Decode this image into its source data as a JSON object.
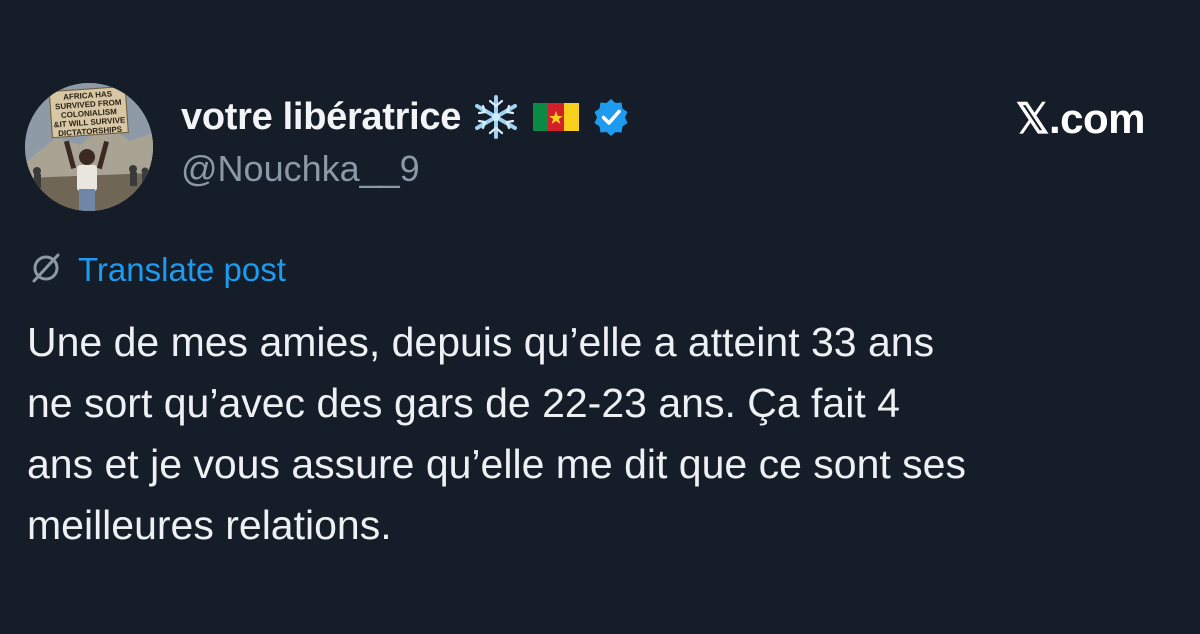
{
  "author": {
    "display_name": "votre libératrice",
    "handle": "@Nouchka__9",
    "name_icons": [
      "snowflake-icon",
      "cameroon-flag-icon",
      "verified-badge-icon"
    ],
    "avatar_sign_text": [
      "AFRICA HAS",
      "SURVIVED FROM",
      "COLONIALISM",
      "&IT WILL SURVIVE",
      "DICTATORSHIPS"
    ]
  },
  "site": {
    "logo_text": "𝕏.com"
  },
  "translate": {
    "label": "Translate post",
    "icon": "globe-slash-icon"
  },
  "post": {
    "text": "Une de mes amies, depuis qu’elle a atteint 33 ans\nne sort qu’avec des gars de 22-23 ans. Ça fait 4\nans et je vous assure qu’elle me dit que ce sont ses\nmeilleures relations."
  },
  "colors": {
    "background": "#151d28",
    "link": "#1d9bf0",
    "verified": "#1d9bf0",
    "muted": "#8b98a5"
  }
}
